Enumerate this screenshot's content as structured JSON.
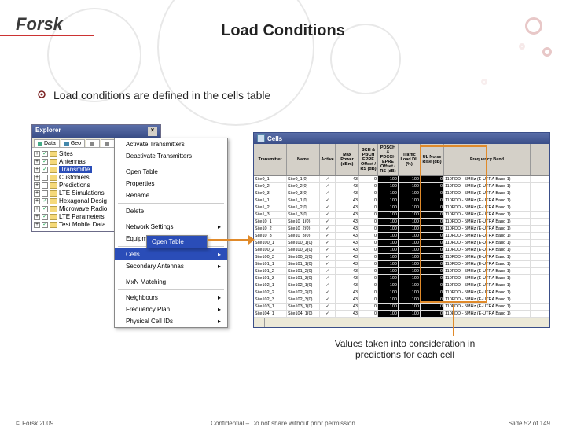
{
  "logo": "Forsk",
  "title": "Load Conditions",
  "bullet": "Load conditions are defined in the cells table",
  "explorer": {
    "title": "Explorer",
    "tabs": [
      "Data",
      "Geo",
      "",
      ""
    ],
    "tree": [
      {
        "expand": "+",
        "chk": "✓",
        "label": "Sites"
      },
      {
        "expand": "+",
        "chk": "✓",
        "label": "Antennas"
      },
      {
        "expand": "+",
        "chk": "✓",
        "label": "Transmitters",
        "selected": true,
        "short": "Transmitte"
      },
      {
        "expand": "+",
        "chk": "",
        "label": "Customers"
      },
      {
        "expand": "+",
        "chk": "",
        "label": "Predictions"
      },
      {
        "expand": "+",
        "chk": "",
        "label": "LTE Simulations"
      },
      {
        "expand": "+",
        "chk": "✓",
        "label": "Hexagonal Desig"
      },
      {
        "expand": "+",
        "chk": "✓",
        "label": "Microwave Radio"
      },
      {
        "expand": "+",
        "chk": "✓",
        "label": "LTE Parameters"
      },
      {
        "expand": "+",
        "chk": "✓",
        "label": "Test Mobile Data"
      }
    ]
  },
  "ctx1": {
    "items_a": [
      "Activate Transmitters",
      "Deactivate Transmitters"
    ],
    "items_b": [
      "Open Table",
      "Properties",
      "Rename"
    ],
    "items_c": [
      "Delete"
    ],
    "items_d": [
      "Network Settings",
      "Equipment"
    ],
    "items_e": [
      "Cells",
      "Secondary Antennas"
    ],
    "items_f": [
      "MxN Matching"
    ],
    "items_g": [
      "Neighbours",
      "Frequency Plan",
      "Physical Cell IDs"
    ]
  },
  "ctx2": {
    "item": "Open Table"
  },
  "cells": {
    "title": "Cells",
    "headers": [
      "Transmitter",
      "Name",
      "Active",
      "Max Power (dBm)",
      "SCH & PBCH EPRE Offset / RS (dB)",
      "PDSCH & PDCCH EPRE Offset / RS (dB)",
      "Traffic Load DL (%)",
      "UL Noise Rise (dB)",
      "Frequency Band"
    ],
    "rows": [
      [
        "Site0_1",
        "Site0_1(0)",
        "✓",
        "43",
        "0",
        "0",
        "100",
        "100",
        "0",
        "110FDD - 5MHz (E-UTRA Band 1)"
      ],
      [
        "Site0_2",
        "Site0_2(0)",
        "✓",
        "43",
        "0",
        "0",
        "100",
        "100",
        "0",
        "110FDD - 5MHz (E-UTRA Band 1)"
      ],
      [
        "Site0_3",
        "Site0_3(0)",
        "✓",
        "43",
        "0",
        "0",
        "100",
        "100",
        "0",
        "110FDD - 5MHz (E-UTRA Band 1)"
      ],
      [
        "Site1_1",
        "Site1_1(0)",
        "✓",
        "43",
        "0",
        "0",
        "100",
        "100",
        "0",
        "110FDD - 5MHz (E-UTRA Band 1)"
      ],
      [
        "Site1_2",
        "Site1_2(0)",
        "✓",
        "43",
        "0",
        "0",
        "100",
        "100",
        "0",
        "110FDD - 5MHz (E-UTRA Band 1)"
      ],
      [
        "Site1_3",
        "Site1_3(0)",
        "✓",
        "43",
        "0",
        "0",
        "100",
        "100",
        "0",
        "110FDD - 5MHz (E-UTRA Band 1)"
      ],
      [
        "Site10_1",
        "Site10_1(0)",
        "✓",
        "43",
        "0",
        "0",
        "100",
        "100",
        "0",
        "110FDD - 5MHz (E-UTRA Band 1)"
      ],
      [
        "Site10_2",
        "Site10_2(0)",
        "✓",
        "43",
        "0",
        "0",
        "100",
        "100",
        "0",
        "110FDD - 5MHz (E-UTRA Band 1)"
      ],
      [
        "Site10_3",
        "Site10_3(0)",
        "✓",
        "43",
        "0",
        "0",
        "100",
        "100",
        "0",
        "110FDD - 5MHz (E-UTRA Band 1)"
      ],
      [
        "Site100_1",
        "Site100_1(0)",
        "✓",
        "43",
        "0",
        "0",
        "100",
        "100",
        "0",
        "110FDD - 5MHz (E-UTRA Band 1)"
      ],
      [
        "Site100_2",
        "Site100_2(0)",
        "✓",
        "43",
        "0",
        "0",
        "100",
        "100",
        "0",
        "110FDD - 5MHz (E-UTRA Band 1)"
      ],
      [
        "Site100_3",
        "Site100_3(0)",
        "✓",
        "43",
        "0",
        "0",
        "100",
        "100",
        "0",
        "110FDD - 5MHz (E-UTRA Band 1)"
      ],
      [
        "Site101_1",
        "Site101_1(0)",
        "✓",
        "43",
        "0",
        "0",
        "100",
        "100",
        "0",
        "110FDD - 5MHz (E-UTRA Band 1)"
      ],
      [
        "Site101_2",
        "Site101_2(0)",
        "✓",
        "43",
        "0",
        "0",
        "100",
        "100",
        "0",
        "110FDD - 5MHz (E-UTRA Band 1)"
      ],
      [
        "Site101_3",
        "Site101_3(0)",
        "✓",
        "43",
        "0",
        "0",
        "100",
        "100",
        "0",
        "110FDD - 5MHz (E-UTRA Band 1)"
      ],
      [
        "Site102_1",
        "Site102_1(0)",
        "✓",
        "43",
        "0",
        "0",
        "100",
        "100",
        "0",
        "110FDD - 5MHz (E-UTRA Band 1)"
      ],
      [
        "Site102_2",
        "Site102_2(0)",
        "✓",
        "43",
        "0",
        "0",
        "100",
        "100",
        "0",
        "110FDD - 5MHz (E-UTRA Band 1)"
      ],
      [
        "Site102_3",
        "Site102_3(0)",
        "✓",
        "43",
        "0",
        "0",
        "100",
        "100",
        "0",
        "110FDD - 5MHz (E-UTRA Band 1)"
      ],
      [
        "Site103_1",
        "Site103_1(0)",
        "✓",
        "43",
        "0",
        "0",
        "100",
        "100",
        "0",
        "110FDD - 5MHz (E-UTRA Band 1)"
      ],
      [
        "Site104_1",
        "Site104_1(0)",
        "✓",
        "43",
        "0",
        "0",
        "100",
        "100",
        "0",
        "110FDD - 5MHz (E-UTRA Band 1)"
      ]
    ]
  },
  "caption": "Values taken into consideration in predictions for each cell",
  "arrow_label": "Open Table",
  "footer": {
    "left": "© Forsk 2009",
    "center": "Confidential – Do not share without prior permission",
    "right": "Slide 52 of 149"
  }
}
